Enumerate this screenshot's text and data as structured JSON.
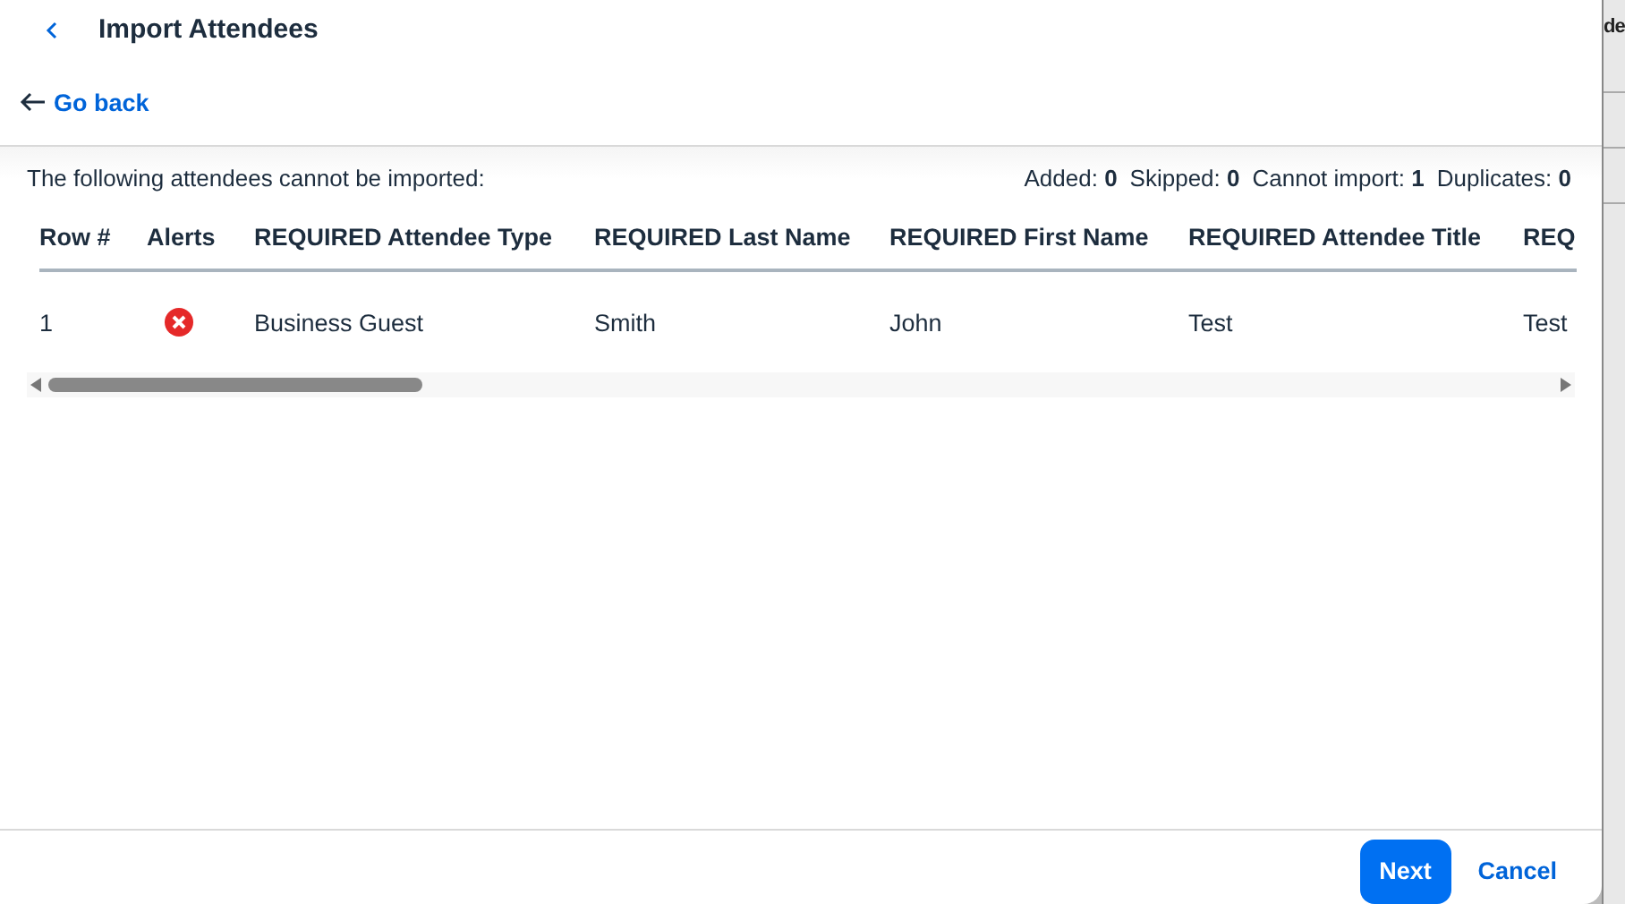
{
  "dialog": {
    "title": "Import Attendees",
    "back_link": "Go back"
  },
  "summary": {
    "message": "The following attendees cannot be imported:",
    "counts": [
      {
        "label": "Added:",
        "value": "0"
      },
      {
        "label": "Skipped:",
        "value": "0"
      },
      {
        "label": "Cannot import:",
        "value": "1"
      },
      {
        "label": "Duplicates:",
        "value": "0"
      }
    ]
  },
  "table": {
    "columns": [
      "Row #",
      "Alerts",
      "REQUIRED Attendee Type",
      "REQUIRED Last Name",
      "REQUIRED First Name",
      "REQUIRED Attendee Title",
      "REQ"
    ],
    "rows": [
      {
        "cells": [
          "1",
          {
            "kind": "error"
          },
          "Business Guest",
          "Smith",
          "John",
          "Test",
          "Test"
        ]
      }
    ]
  },
  "buttons": [
    {
      "label": "Next",
      "kind": "primary"
    },
    {
      "label": "Cancel",
      "kind": "link"
    }
  ],
  "background": {
    "visible_text": "de"
  }
}
